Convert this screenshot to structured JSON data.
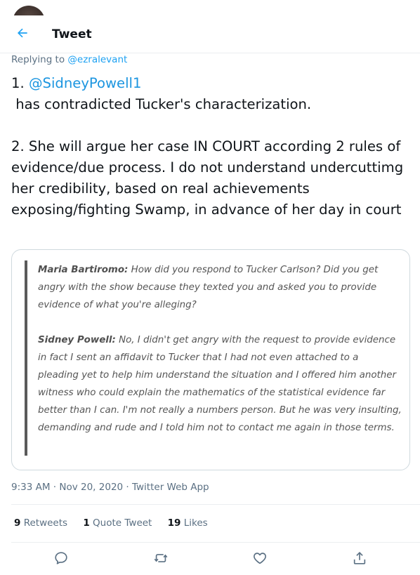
{
  "header": {
    "title": "Tweet"
  },
  "tweet": {
    "replying_prefix": "Replying to ",
    "replying_handle": "@ezralevant",
    "line1_prefix": "1. ",
    "mention": "@SidneyPowell1",
    "text_rest": "\n has contradicted Tucker's characterization.\n\n2. She will argue her case IN COURT according 2 rules of evidence/due process. I do not understand undercuttimg her credibility, based on real achievements exposing/fighting Swamp, in advance of her day in court",
    "time": "9:33 AM · Nov 20, 2020 · Twitter Web App"
  },
  "quote_card": {
    "speaker1": "Maria Bartiromo:",
    "text1": " How did you respond to Tucker Carlson? Did you get angry with the show because they texted you and asked you to provide evidence of what you're alleging?",
    "speaker2": "Sidney Powell:",
    "text2": " No, I didn't get angry with the request to provide evidence in fact I sent an affidavit to Tucker that I had not even attached to a pleading yet to help him understand the situation and I offered him another witness who could explain the mathematics of the statistical evidence far better than I can. I'm not really a numbers person. But he was very insulting, demanding and rude and I told him not to contact me again in those terms."
  },
  "stats": {
    "retweets_count": "9",
    "retweets_label": " Retweets",
    "quotes_count": "1",
    "quotes_label": " Quote Tweet",
    "likes_count": "19",
    "likes_label": " Likes"
  },
  "icons": {
    "back": "arrow-left-icon",
    "reply": "reply-icon",
    "retweet": "retweet-icon",
    "like": "heart-icon",
    "share": "share-icon",
    "accent": "#1da1f2"
  }
}
